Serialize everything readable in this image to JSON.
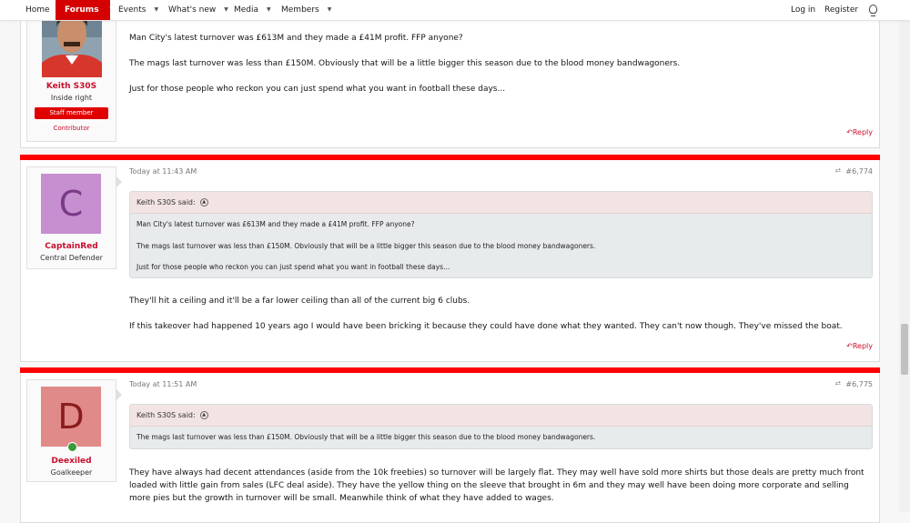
{
  "nav": {
    "home": "Home",
    "forums": "Forums",
    "events": "Events",
    "whats_new": "What's new",
    "media": "Media",
    "members": "Members",
    "login": "Log in",
    "register": "Register"
  },
  "post1": {
    "username": "Keith S30S",
    "user_title": "Inside right",
    "badge": "Staff member",
    "banner": "Contributor",
    "lines": [
      "Man City's latest turnover was £613M and they made a £41M profit. FFP anyone?",
      "The mags last turnover was less than £150M. Obviously that will be a little bigger this season due to the blood money bandwagoners.",
      "Just for those people who reckon you can just spend what you want in football these days..."
    ],
    "reply": "Reply"
  },
  "post2": {
    "avatar_letter": "C",
    "avatar_color": "#c58fd0",
    "username": "CaptainRed",
    "user_title": "Central Defender",
    "time": "Today at 11:43 AM",
    "number": "#6,774",
    "quote_author": "Keith S30S said:",
    "quote_lines": [
      "Man City's latest turnover was £613M and they made a £41M profit. FFP anyone?",
      "The mags last turnover was less than £150M. Obviously that will be a little bigger this season due to the blood money bandwagoners.",
      "Just for those people who reckon you can just spend what you want in football these days..."
    ],
    "lines": [
      "They'll hit a ceiling and it'll be a far lower ceiling than all of the current big 6 clubs.",
      "If this takeover had happened 10 years ago I would have been bricking it because they could have done what they wanted. They can't now though. They've missed the boat."
    ],
    "reply": "Reply"
  },
  "post3": {
    "avatar_letter": "D",
    "avatar_color": "#e08a8a",
    "username": "Deexiled",
    "user_title": "Goalkeeper",
    "time": "Today at 11:51 AM",
    "number": "#6,775",
    "quote_author": "Keith S30S said:",
    "quote_lines": [
      "The mags last turnover was less than £150M. Obviously that will be a little bigger this season due to the blood money bandwagoners."
    ],
    "body": "They have always had decent attendances (aside from the 10k freebies) so turnover will be largely flat. They may well have sold more shirts but those deals are pretty much front loaded with little gain from sales (LFC deal aside). They have the yellow thing on the sleeve that brought in 6m and they may well have been doing more corporate and selling more pies but the growth in turnover will be small. Meanwhile think of what they have added to wages."
  },
  "colors": {
    "accent": "#ff0000",
    "nav_active": "#d50000",
    "username": "#c8102e"
  }
}
